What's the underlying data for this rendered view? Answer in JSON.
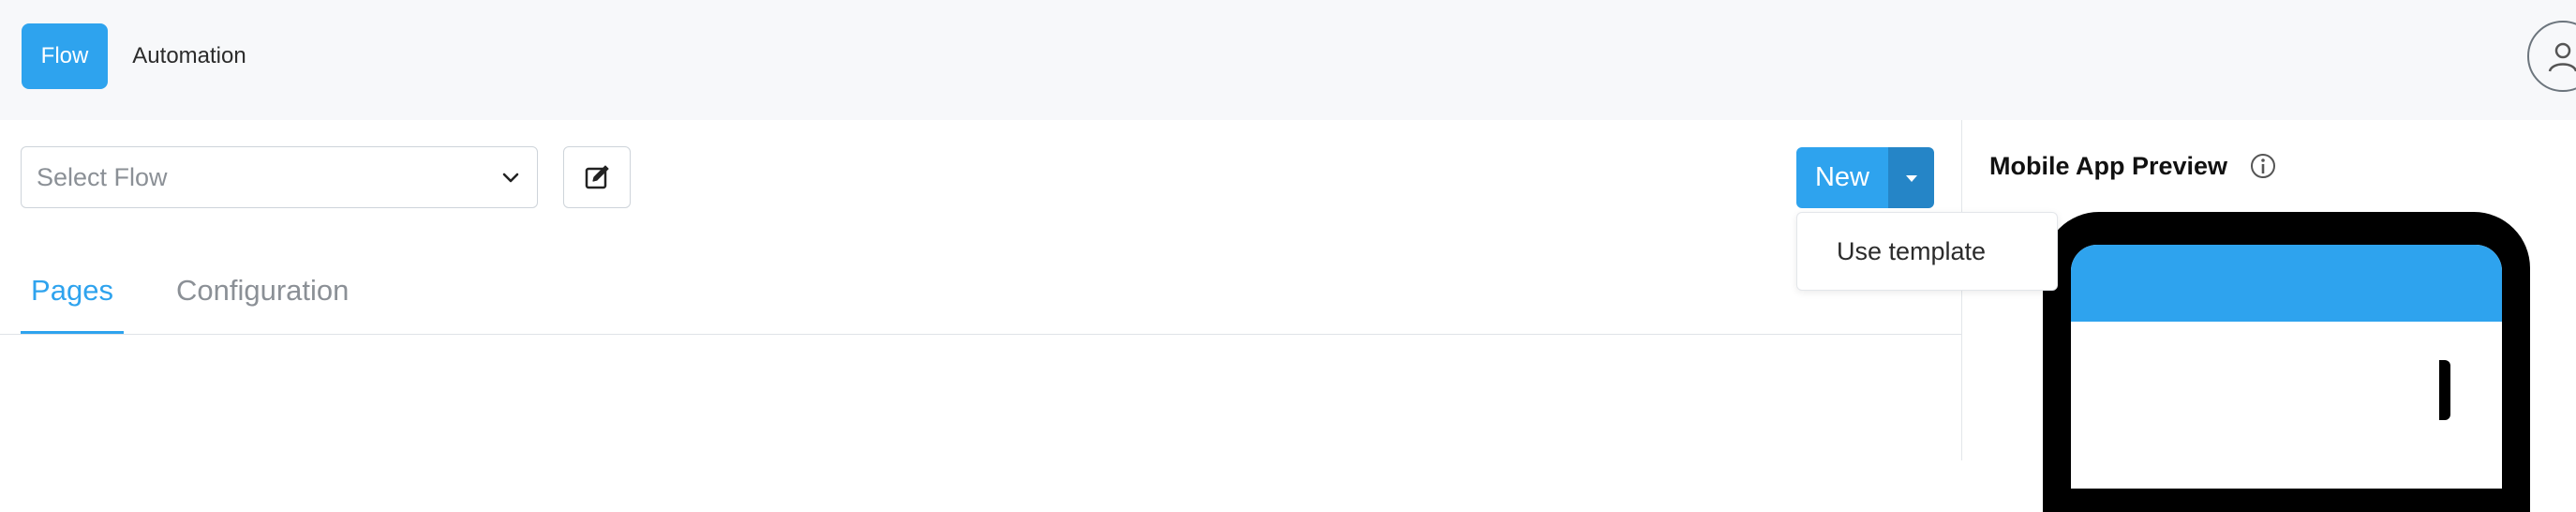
{
  "nav": {
    "tabs": [
      {
        "label": "Flow",
        "active": true
      },
      {
        "label": "Automation",
        "active": false
      }
    ],
    "avatar_icon": "user-icon"
  },
  "flow_selector": {
    "placeholder": "Select Flow",
    "icon": "chevron-down-icon"
  },
  "edit_button": {
    "icon": "edit-icon"
  },
  "new_button": {
    "label": "New",
    "dropdown_icon": "caret-down-icon",
    "dropdown_items": [
      "Use template"
    ]
  },
  "content_tabs": [
    {
      "label": "Pages",
      "active": true
    },
    {
      "label": "Configuration",
      "active": false
    }
  ],
  "preview": {
    "title": "Mobile App Preview",
    "info_icon": "info-icon"
  },
  "colors": {
    "accent": "#2ea3ee",
    "accent_dark": "#2585c7",
    "topbar_bg": "#f7f8fa",
    "border": "#ced4da",
    "muted_text": "#8b9096"
  }
}
